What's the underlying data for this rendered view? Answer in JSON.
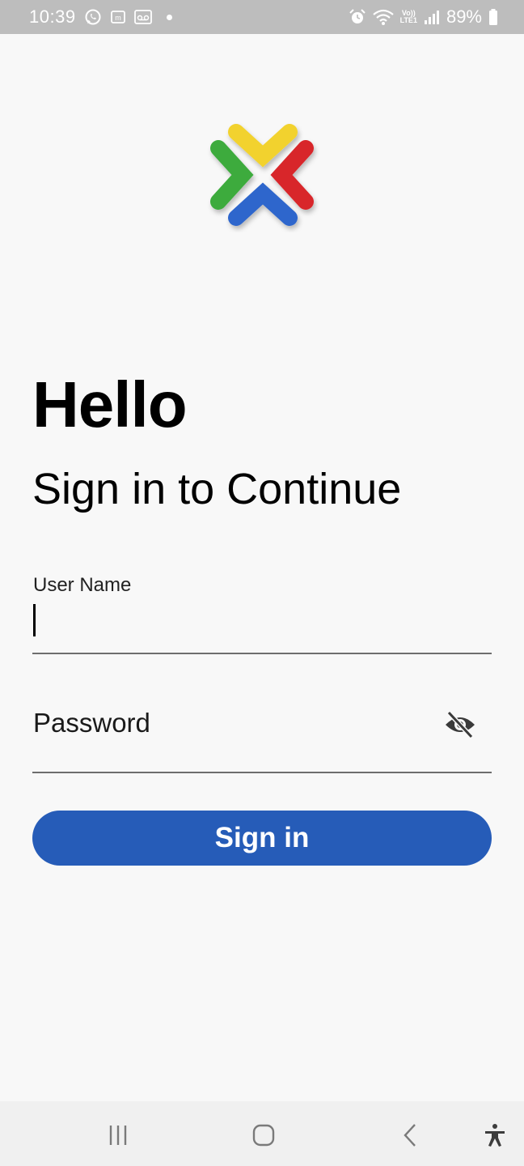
{
  "status_bar": {
    "time": "10:39",
    "battery": "89%",
    "volte_top": "Vo))",
    "volte_bottom": "LTE1",
    "icons": [
      "whatsapp-icon",
      "messages-icon",
      "voicemail-icon",
      "notification-dot",
      "alarm-icon",
      "wifi-icon",
      "volte-icon",
      "signal-icon",
      "battery-icon"
    ]
  },
  "login": {
    "greeting": "Hello",
    "subtitle": "Sign in to Continue",
    "username_label": "User Name",
    "username_value": "",
    "password_placeholder": "Password",
    "password_value": "",
    "signin_label": "Sign in"
  },
  "nav_bar": {
    "icons": [
      "recents-icon",
      "home-icon",
      "back-icon",
      "accessibility-icon"
    ]
  },
  "colors": {
    "primary": "#265cb8",
    "status_bar": "#bdbdbd",
    "background": "#f8f8f8",
    "logo_yellow": "#f2d22e",
    "logo_red": "#d8262b",
    "logo_green": "#3cab3c",
    "logo_blue": "#2f66cc"
  }
}
